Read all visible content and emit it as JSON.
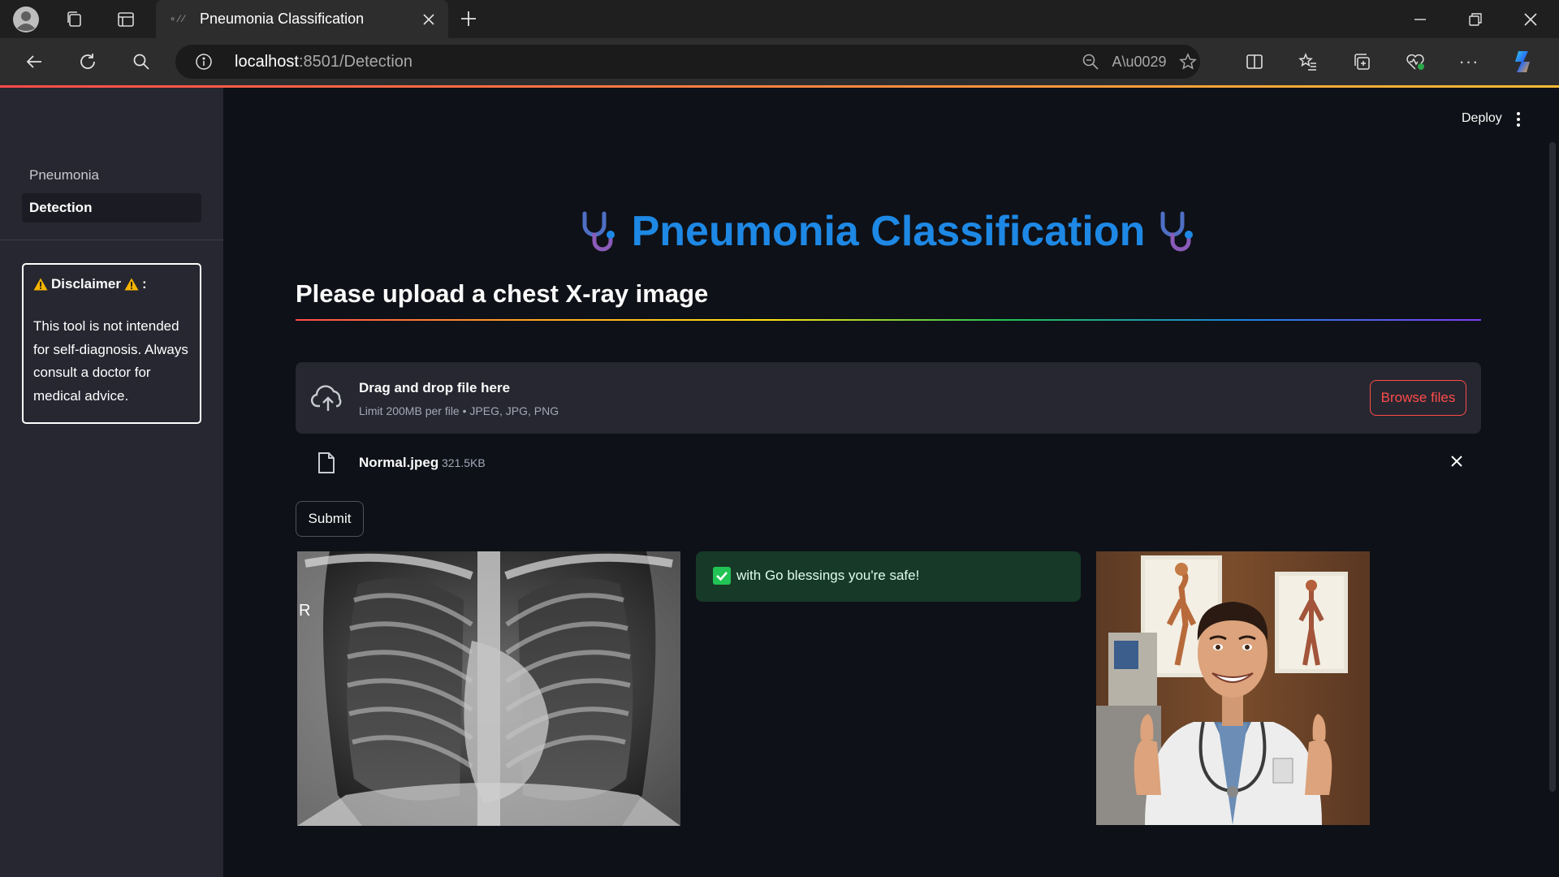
{
  "browser": {
    "tab_title": "Pneumonia Classification",
    "url_host": "localhost",
    "url_path": ":8501/Detection"
  },
  "sidebar": {
    "items": [
      {
        "label": "Pneumonia",
        "active": false
      },
      {
        "label": "Detection",
        "active": true
      }
    ],
    "disclaimer": {
      "title": "Disclaimer",
      "title_suffix": ":",
      "body": "This tool is not intended for self-diagnosis. Always consult a doctor for medical advice."
    }
  },
  "header": {
    "deploy_label": "Deploy"
  },
  "main": {
    "title": "Pneumonia Classification",
    "subheader": "Please upload a chest X-ray image",
    "uploader": {
      "drag_text": "Drag and drop file here",
      "limit_text": "Limit 200MB per file • JPEG, JPG, PNG",
      "browse_label": "Browse files"
    },
    "uploaded_file": {
      "name": "Normal.jpeg",
      "size": "321.5KB"
    },
    "submit_label": "Submit",
    "xray_marker": "R",
    "result_message": "with Go blessings you're safe!"
  },
  "colors": {
    "accent": "#ff4b4b",
    "title_blue": "#1e88e5",
    "success_bg": "#173928",
    "background": "#0e1117",
    "sidebar_bg": "#262730"
  }
}
